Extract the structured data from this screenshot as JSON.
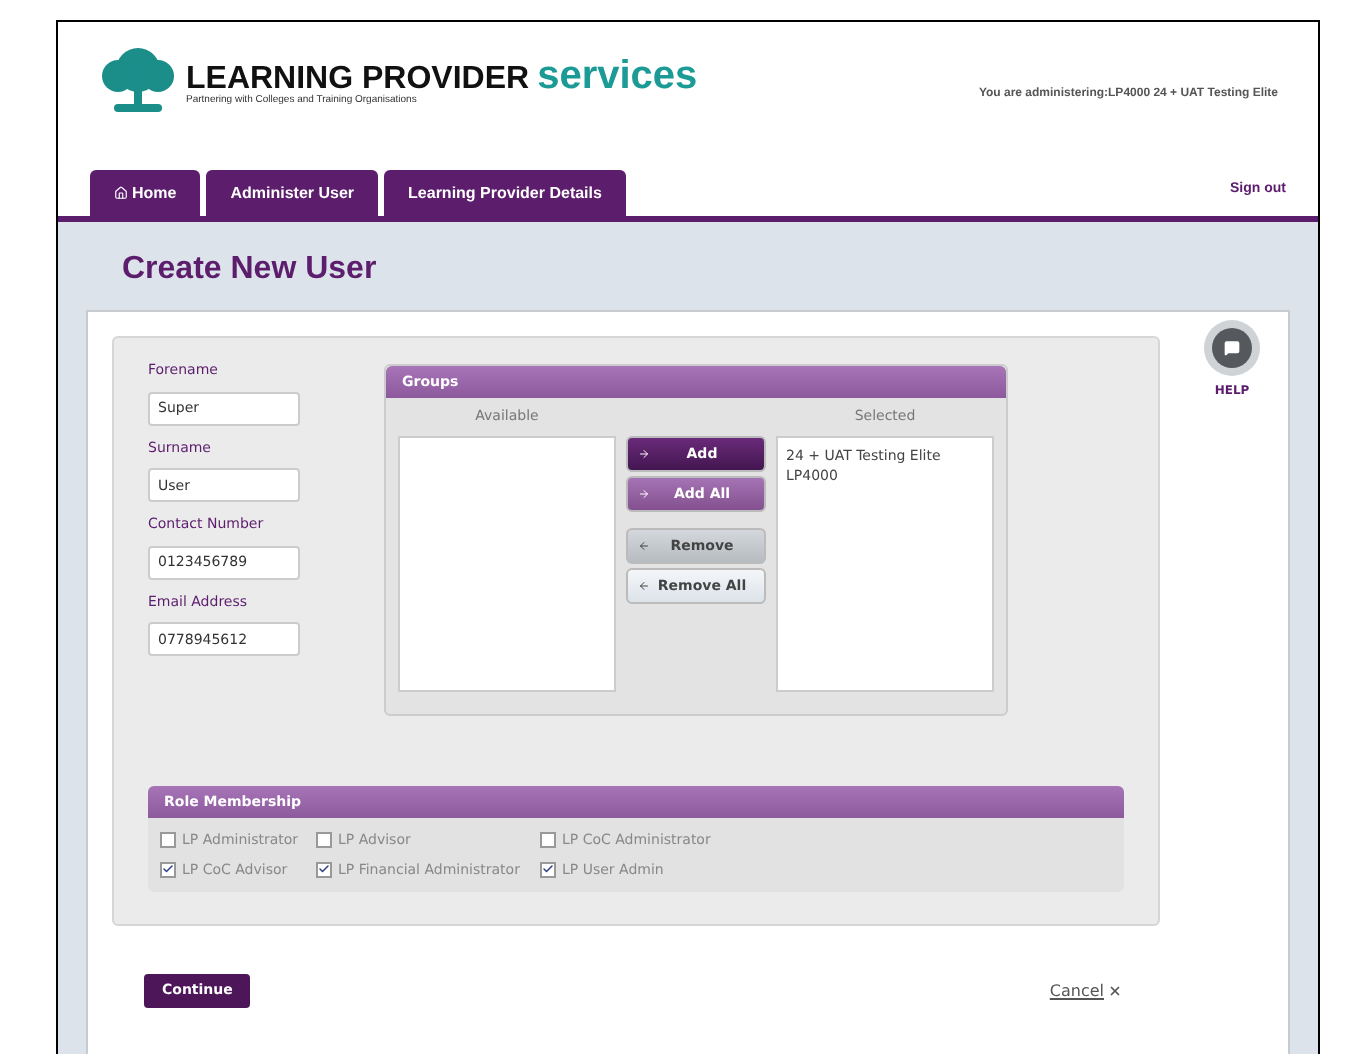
{
  "header": {
    "brand_main": "LEARNING PROVIDER",
    "brand_accent": "services",
    "tagline": "Partnering with Colleges and Training Organisations",
    "administering": "You are administering:LP4000 24 + UAT Testing Elite"
  },
  "tabs": [
    {
      "label": "Home",
      "selected": false
    },
    {
      "label": "Administer User",
      "selected": false
    },
    {
      "label": "Learning Provider Details",
      "selected": false
    }
  ],
  "sign_out": "Sign out",
  "page_title": "Create New User",
  "fields": [
    {
      "label": "Forename",
      "value": "Super"
    },
    {
      "label": "Surname",
      "value": "User"
    },
    {
      "label": "Contact Number",
      "value": "0123456789"
    },
    {
      "label": "Email Address",
      "value": "0778945612"
    }
  ],
  "groups": {
    "title": "Groups",
    "available_label": "Available",
    "selected_label": "Selected",
    "selected_items": [
      "24 + UAT Testing Elite",
      "LP4000"
    ],
    "buttons": [
      {
        "label": "Add",
        "kind": "add"
      },
      {
        "label": "Add All",
        "kind": "add_all"
      },
      {
        "label": "Remove",
        "kind": "remove"
      },
      {
        "label": "Remove All",
        "kind": "remove_all"
      }
    ]
  },
  "help": {
    "label": "HELP"
  },
  "roles": {
    "title": "Role Membership",
    "items": [
      {
        "label": "LP Administrator",
        "checked": false
      },
      {
        "label": "LP Advisor",
        "checked": false
      },
      {
        "label": "LP CoC Administrator",
        "checked": false
      },
      {
        "label": "LP CoC Advisor",
        "checked": true
      },
      {
        "label": "LP Financial Administrator",
        "checked": true
      },
      {
        "label": "LP User Admin",
        "checked": true
      }
    ]
  },
  "continue": "Continue",
  "cancel": "Cancel"
}
